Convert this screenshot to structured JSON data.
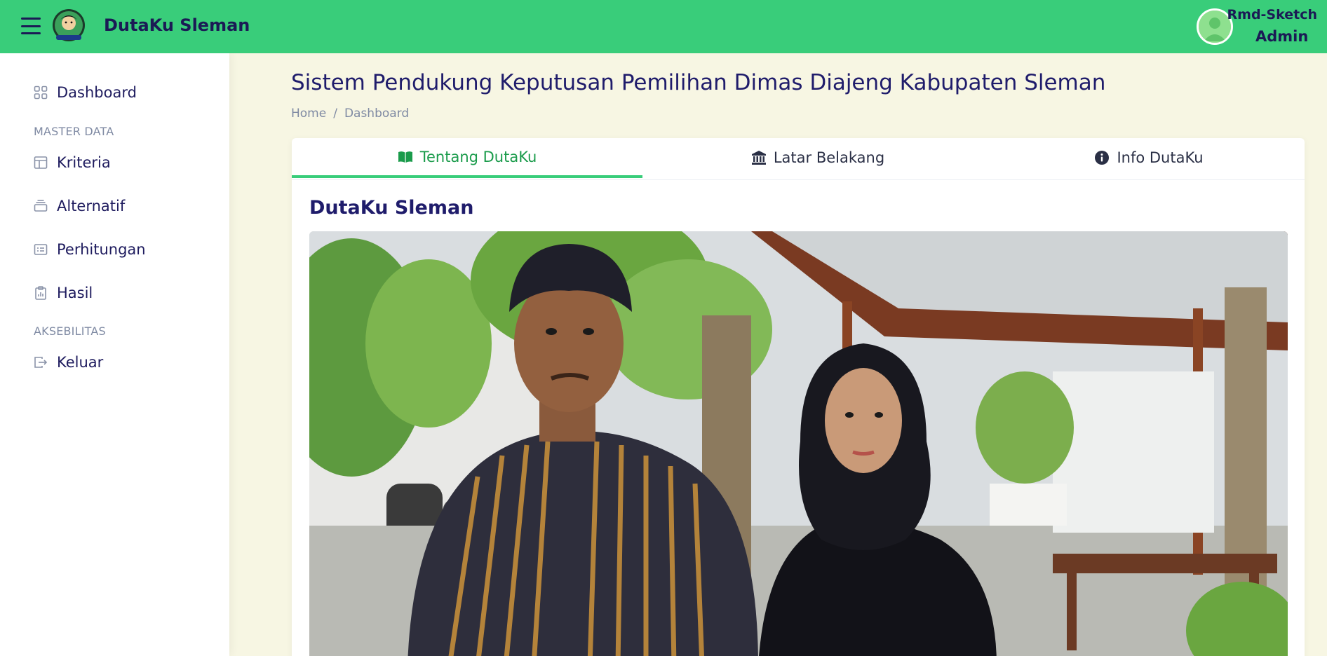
{
  "app": {
    "brand": "DutaKu Sleman",
    "user_name": "Rmd-Sketch",
    "user_role": "Admin"
  },
  "sidebar": {
    "items": [
      {
        "label": "Dashboard",
        "icon": "grid-icon"
      },
      {
        "heading": "MASTER DATA"
      },
      {
        "label": "Kriteria",
        "icon": "layout-icon"
      },
      {
        "label": "Alternatif",
        "icon": "layers-icon"
      },
      {
        "label": "Perhitungan",
        "icon": "list-card-icon"
      },
      {
        "label": "Hasil",
        "icon": "clipboard-chart-icon"
      },
      {
        "heading": "AKSEBILITAS"
      },
      {
        "label": "Keluar",
        "icon": "logout-icon"
      }
    ]
  },
  "main": {
    "title": "Sistem Pendukung Keputusan Pemilihan Dimas Diajeng Kabupaten Sleman",
    "breadcrumb": [
      "Home",
      "Dashboard"
    ],
    "tabs": [
      {
        "label": "Tentang DutaKu",
        "icon": "book-open-icon",
        "active": true
      },
      {
        "label": "Latar Belakang",
        "icon": "bank-icon",
        "active": false
      },
      {
        "label": "Info DutaKu",
        "icon": "info-circle-icon",
        "active": false
      }
    ],
    "card_title": "DutaKu Sleman"
  },
  "colors": {
    "topbar": "#39cd7a",
    "text_primary": "#1e1b5e",
    "active_tab": "#1a9b4b",
    "background": "#f7f6e3"
  }
}
